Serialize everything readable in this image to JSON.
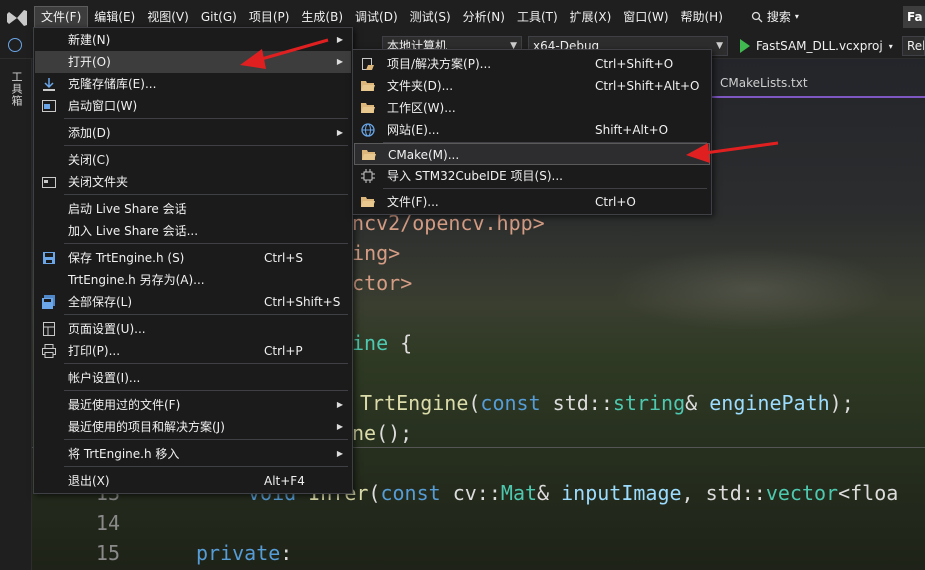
{
  "menubar": {
    "items": [
      "文件(F)",
      "编辑(E)",
      "视图(V)",
      "Git(G)",
      "项目(P)",
      "生成(B)",
      "调试(D)",
      "测试(S)",
      "分析(N)",
      "工具(T)",
      "扩展(X)",
      "窗口(W)",
      "帮助(H)"
    ],
    "search": "搜索",
    "title_tab": "Fa"
  },
  "toolbar": {
    "target": "本地计算机",
    "config": "x64-Debug",
    "run": "FastSAM_DLL.vcxproj",
    "right": "Rel"
  },
  "left_strip": {
    "toolbox": "工具箱"
  },
  "editor": {
    "doc_tab": "CMakeLists.txt",
    "lines": {
      "l1": "encv2/opencv.hpp>",
      "l2": "ring>",
      "l3": "ector>",
      "l4a": "ine",
      "l4b": " {",
      "l5a": "TrtEngine",
      "l5b": "(",
      "l5c": "const",
      "l5d": " std::",
      "l5e": "string",
      "l5f": "& ",
      "l5g": "enginePath",
      "l5h": ");",
      "l6a": "ne",
      "l6b": "();",
      "l7num": "13",
      "l7a": "void",
      "l7b": " Infer",
      "l7c": "(",
      "l7d": "const",
      "l7e": " cv::",
      "l7f": "Mat",
      "l7g": "& ",
      "l7h": "inputImage",
      "l7i": ", std::",
      "l7j": "vector",
      "l7k": "<floa",
      "l8num": "14",
      "l9num": "15",
      "l9a": "private",
      "l9b": ":"
    }
  },
  "file_menu": {
    "items": [
      {
        "label": "新建(N)",
        "shortcut": "",
        "arrow": true
      },
      {
        "label": "打开(O)",
        "shortcut": "",
        "arrow": true
      },
      {
        "label": "克隆存储库(E)...",
        "shortcut": "",
        "arrow": false
      },
      {
        "label": "启动窗口(W)",
        "shortcut": "",
        "arrow": false
      },
      {
        "label": "添加(D)",
        "shortcut": "",
        "arrow": true
      },
      {
        "label": "关闭(C)",
        "shortcut": "",
        "arrow": false
      },
      {
        "label": "关闭文件夹",
        "shortcut": "",
        "arrow": false
      },
      {
        "label": "启动 Live Share 会话",
        "shortcut": "",
        "arrow": false
      },
      {
        "label": "加入 Live Share 会话...",
        "shortcut": "",
        "arrow": false
      },
      {
        "label": "保存 TrtEngine.h (S)",
        "shortcut": "Ctrl+S",
        "arrow": false
      },
      {
        "label": "TrtEngine.h 另存为(A)...",
        "shortcut": "",
        "arrow": false
      },
      {
        "label": "全部保存(L)",
        "shortcut": "Ctrl+Shift+S",
        "arrow": false
      },
      {
        "label": "页面设置(U)...",
        "shortcut": "",
        "arrow": false
      },
      {
        "label": "打印(P)...",
        "shortcut": "Ctrl+P",
        "arrow": false
      },
      {
        "label": "帐户设置(I)...",
        "shortcut": "",
        "arrow": false
      },
      {
        "label": "最近使用过的文件(F)",
        "shortcut": "",
        "arrow": true
      },
      {
        "label": "最近使用的项目和解决方案(J)",
        "shortcut": "",
        "arrow": true
      },
      {
        "label": "将 TrtEngine.h 移入",
        "shortcut": "",
        "arrow": true
      },
      {
        "label": "退出(X)",
        "shortcut": "Alt+F4",
        "arrow": false
      }
    ]
  },
  "open_menu": {
    "items": [
      {
        "label": "项目/解决方案(P)...",
        "shortcut": "Ctrl+Shift+O"
      },
      {
        "label": "文件夹(D)...",
        "shortcut": "Ctrl+Shift+Alt+O"
      },
      {
        "label": "工作区(W)...",
        "shortcut": ""
      },
      {
        "label": "网站(E)...",
        "shortcut": "Shift+Alt+O"
      },
      {
        "label": "CMake(M)...",
        "shortcut": ""
      },
      {
        "label": "导入 STM32CubeIDE 项目(S)...",
        "shortcut": ""
      },
      {
        "label": "文件(F)...",
        "shortcut": "Ctrl+O"
      }
    ]
  },
  "colors": {
    "accent": "#7e57c2",
    "annotation_arrow": "#e02020"
  }
}
